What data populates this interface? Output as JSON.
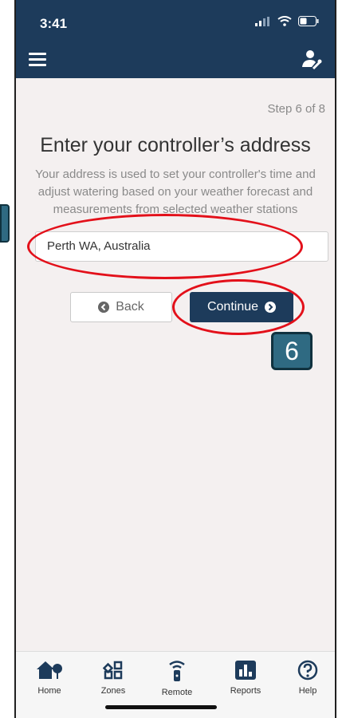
{
  "status": {
    "time": "3:41"
  },
  "header": {
    "menu_icon": "hamburger-icon",
    "settings_icon": "user-wrench-icon"
  },
  "main": {
    "step": "Step 6 of 8",
    "title": "Enter your controller’s address",
    "description": "Your address is used to set your controller's time and adjust watering based on your weather forecast and measurements from selected weather stations",
    "address_value": "Perth WA, Australia",
    "back_label": "Back",
    "continue_label": "Continue"
  },
  "annotation": {
    "step_badge": "6"
  },
  "tabs": [
    {
      "label": "Home",
      "icon": "home-tree-icon"
    },
    {
      "label": "Zones",
      "icon": "zones-grid-icon"
    },
    {
      "label": "Remote",
      "icon": "remote-icon"
    },
    {
      "label": "Reports",
      "icon": "reports-chart-icon"
    },
    {
      "label": "Help",
      "icon": "help-icon"
    }
  ],
  "colors": {
    "header": "#1d3b5b",
    "accent": "#e3101a",
    "badge": "#2f6a82"
  }
}
